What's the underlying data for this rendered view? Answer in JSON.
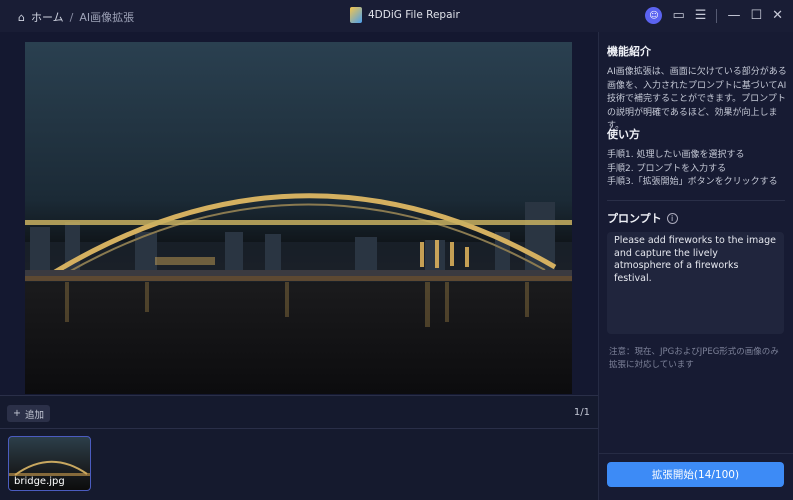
{
  "titlebar": {
    "home_label": "ホーム",
    "separator": "/",
    "current": "AI画像拡張",
    "app_title": "4DDiG File Repair"
  },
  "image": {
    "filename": "bridge.jpg",
    "page_count": "1/1",
    "add_label": "追加"
  },
  "side": {
    "intro_title": "機能紹介",
    "intro_text": "AI画像拡張は、画面に欠けている部分がある画像を、入力されたプロンプトに基づいてAI技術で補完することができます。プロンプトの説明が明確であるほど、効果が向上します。",
    "howto_title": "使い方",
    "steps": [
      "手順1. 処理したい画像を選択する",
      "手順2. プロンプトを入力する",
      "手順3.「拡張開始」ボタンをクリックする"
    ],
    "prompt_title": "プロンプト",
    "prompt_value": "Please add fireworks to the image and capture the lively atmosphere of a fireworks festival.",
    "note": "注意：現在、JPGおよびJPEG形式の画像のみ拡張に対応しています",
    "start_label": "拡張開始(14/100)"
  },
  "colors": {
    "accent": "#3d8bf6",
    "bg": "#151a2e"
  }
}
